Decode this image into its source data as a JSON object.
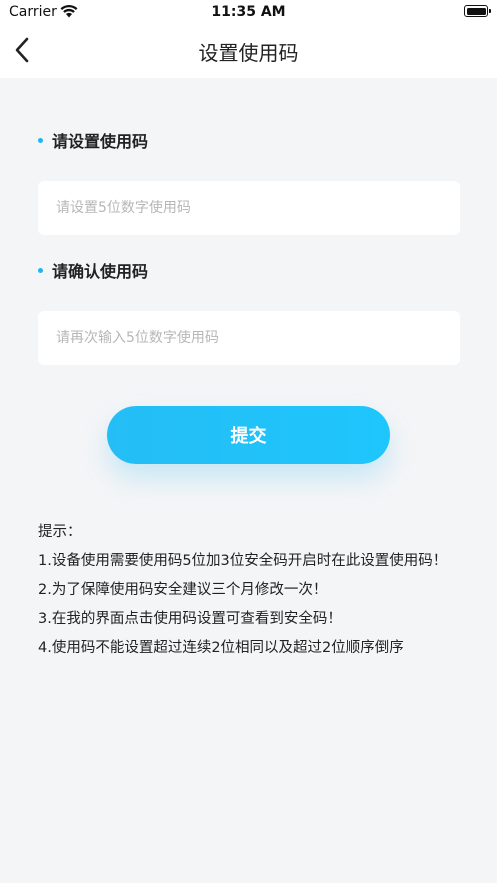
{
  "status_bar": {
    "carrier": "Carrier",
    "time": "11:35 AM"
  },
  "nav": {
    "title": "设置使用码",
    "back_icon": "chevron-left-icon"
  },
  "form": {
    "set_label": "请设置使用码",
    "set_placeholder": "请设置5位数字使用码",
    "confirm_label": "请确认使用码",
    "confirm_placeholder": "请再次输入5位数字使用码",
    "submit_label": "提交"
  },
  "tips": {
    "heading": "提示：",
    "lines": [
      "1.设备使用需要使用码5位加3位安全码开启时在此设置使用码！",
      "2.为了保障使用码安全建议三个月修改一次！",
      "3.在我的界面点击使用码设置可查看到安全码！",
      "4.使用码不能设置超过连续2位相同以及超过2位顺序倒序"
    ]
  },
  "colors": {
    "accent": "#1ec6fc",
    "background": "#f4f5f7"
  }
}
